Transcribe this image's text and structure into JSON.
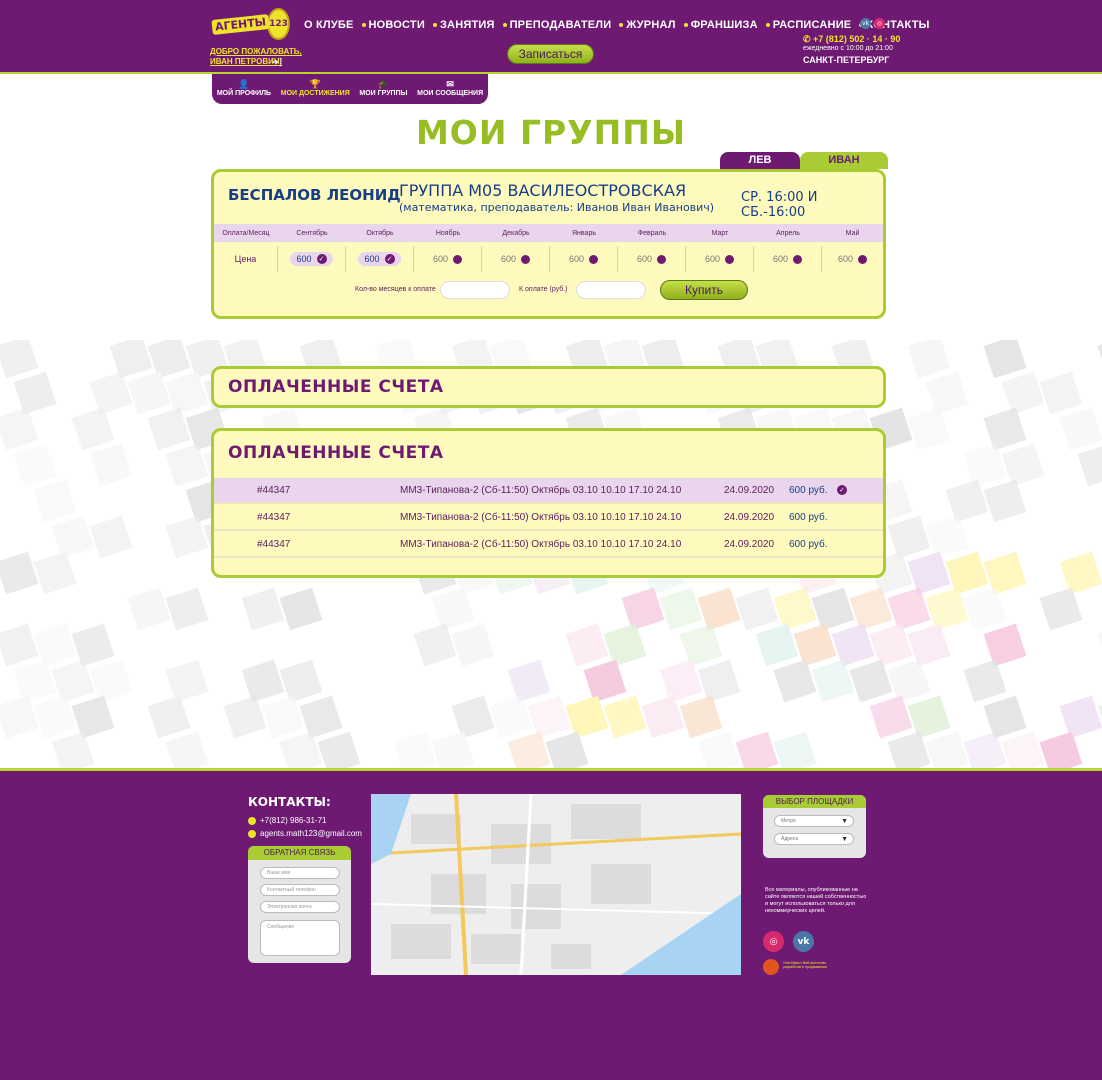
{
  "header": {
    "logo_text": "АГЕНТЫ",
    "logo_badge": "123",
    "welcome_line1": "ДОБРО ПОЖАЛОВАТЬ,",
    "welcome_line2": "ИВАН ПЕТРОВИЧ!",
    "nav": [
      "О КЛУБЕ",
      "НОВОСТИ",
      "ЗАНЯТИЯ",
      "ПРЕПОДАВАТЕЛИ",
      "ЖУРНАЛ",
      "ФРАНШИЗА",
      "РАСПИСАНИЕ",
      "КОНТАКТЫ"
    ],
    "signup_label": "Записаться",
    "phone": "+7 (812) 502 · 14 · 90",
    "hours": "ежедневно с 10:00 до 21:00",
    "city": "САНКТ-ПЕТЕРБУРГ"
  },
  "subnav": {
    "items": [
      {
        "label": "МОЙ ПРОФИЛЬ",
        "icon": "user-icon",
        "active": false
      },
      {
        "label": "МОИ ДОСТИЖЕНИЯ",
        "icon": "trophy-icon",
        "active": true
      },
      {
        "label": "МОИ ГРУППЫ",
        "icon": "graduation-cap-icon",
        "active": false
      },
      {
        "label": "МОИ СООБЩЕНИЯ",
        "icon": "envelope-icon",
        "active": false
      }
    ]
  },
  "page": {
    "title": "МОИ ГРУППЫ",
    "child_tabs": [
      "ЛЕВ",
      "ИВАН"
    ]
  },
  "group": {
    "student": "БЕСПАЛОВ ЛЕОНИД",
    "name": "ГРУППА М05 ВАСИЛЕОСТРОВСКАЯ",
    "subtitle": "(математика, преподаватель: Иванов Иван Иванович)",
    "schedule": "СР. 16:00 И СБ.-16:00",
    "months_header": [
      "Оплата/Месяц",
      "Сентябрь",
      "Октябрь",
      "Ноябрь",
      "Декабрь",
      "Январь",
      "Февраль",
      "Март",
      "Апрель",
      "Май"
    ],
    "price_label": "Цена",
    "prices": [
      {
        "value": "600",
        "paid": true
      },
      {
        "value": "600",
        "paid": true
      },
      {
        "value": "600",
        "paid": false
      },
      {
        "value": "600",
        "paid": false
      },
      {
        "value": "600",
        "paid": false
      },
      {
        "value": "600",
        "paid": false
      },
      {
        "value": "600",
        "paid": false
      },
      {
        "value": "600",
        "paid": false
      },
      {
        "value": "600",
        "paid": false
      }
    ],
    "months_count_label": "Кол-во месяцев к оплате",
    "to_pay_label": "К оплате (руб.)",
    "buy_label": "Купить"
  },
  "paid": {
    "title_collapsed": "ОПЛАЧЕННЫЕ СЧЕТА",
    "title_expanded": "ОПЛАЧЕННЫЕ СЧЕТА",
    "invoices": [
      {
        "number": "#44347",
        "desc": "ММ3-Типанова-2 (Сб-11:50) Октябрь 03.10 10.10 17.10 24.10",
        "date": "24.09.2020",
        "amount": "600 руб.",
        "checked": true
      },
      {
        "number": "#44347",
        "desc": "ММ3-Типанова-2 (Сб-11:50) Октябрь 03.10 10.10 17.10 24.10",
        "date": "24.09.2020",
        "amount": "600 руб.",
        "checked": false
      },
      {
        "number": "#44347",
        "desc": "ММ3-Типанова-2 (Сб-11:50) Октябрь 03.10 10.10 17.10 24.10",
        "date": "24.09.2020",
        "amount": "600 руб.",
        "checked": false
      }
    ]
  },
  "footer": {
    "contacts_title": "КОНТАКТЫ:",
    "phone": "+7(812) 986-31-71",
    "email": "agents.math123@gmail.com",
    "feedback_title": "ОБРАТНАЯ СВЯЗЬ",
    "fb_name": "Ваше имя",
    "fb_phone": "Контактный телефон",
    "fb_email": "Электронная почта",
    "fb_message": "Сообщение",
    "venue_title": "ВЫБОР ПЛОЩАДКИ",
    "venue_metro": "Метро",
    "venue_address": "Адреса",
    "legal": "Все материалы, опубликованные на сайте являются нашей собственностью и могут использоваться только для некоммерческих целей.",
    "dev_text": "«ЧатОфис» Веб-агентство разработки и продвижения"
  }
}
